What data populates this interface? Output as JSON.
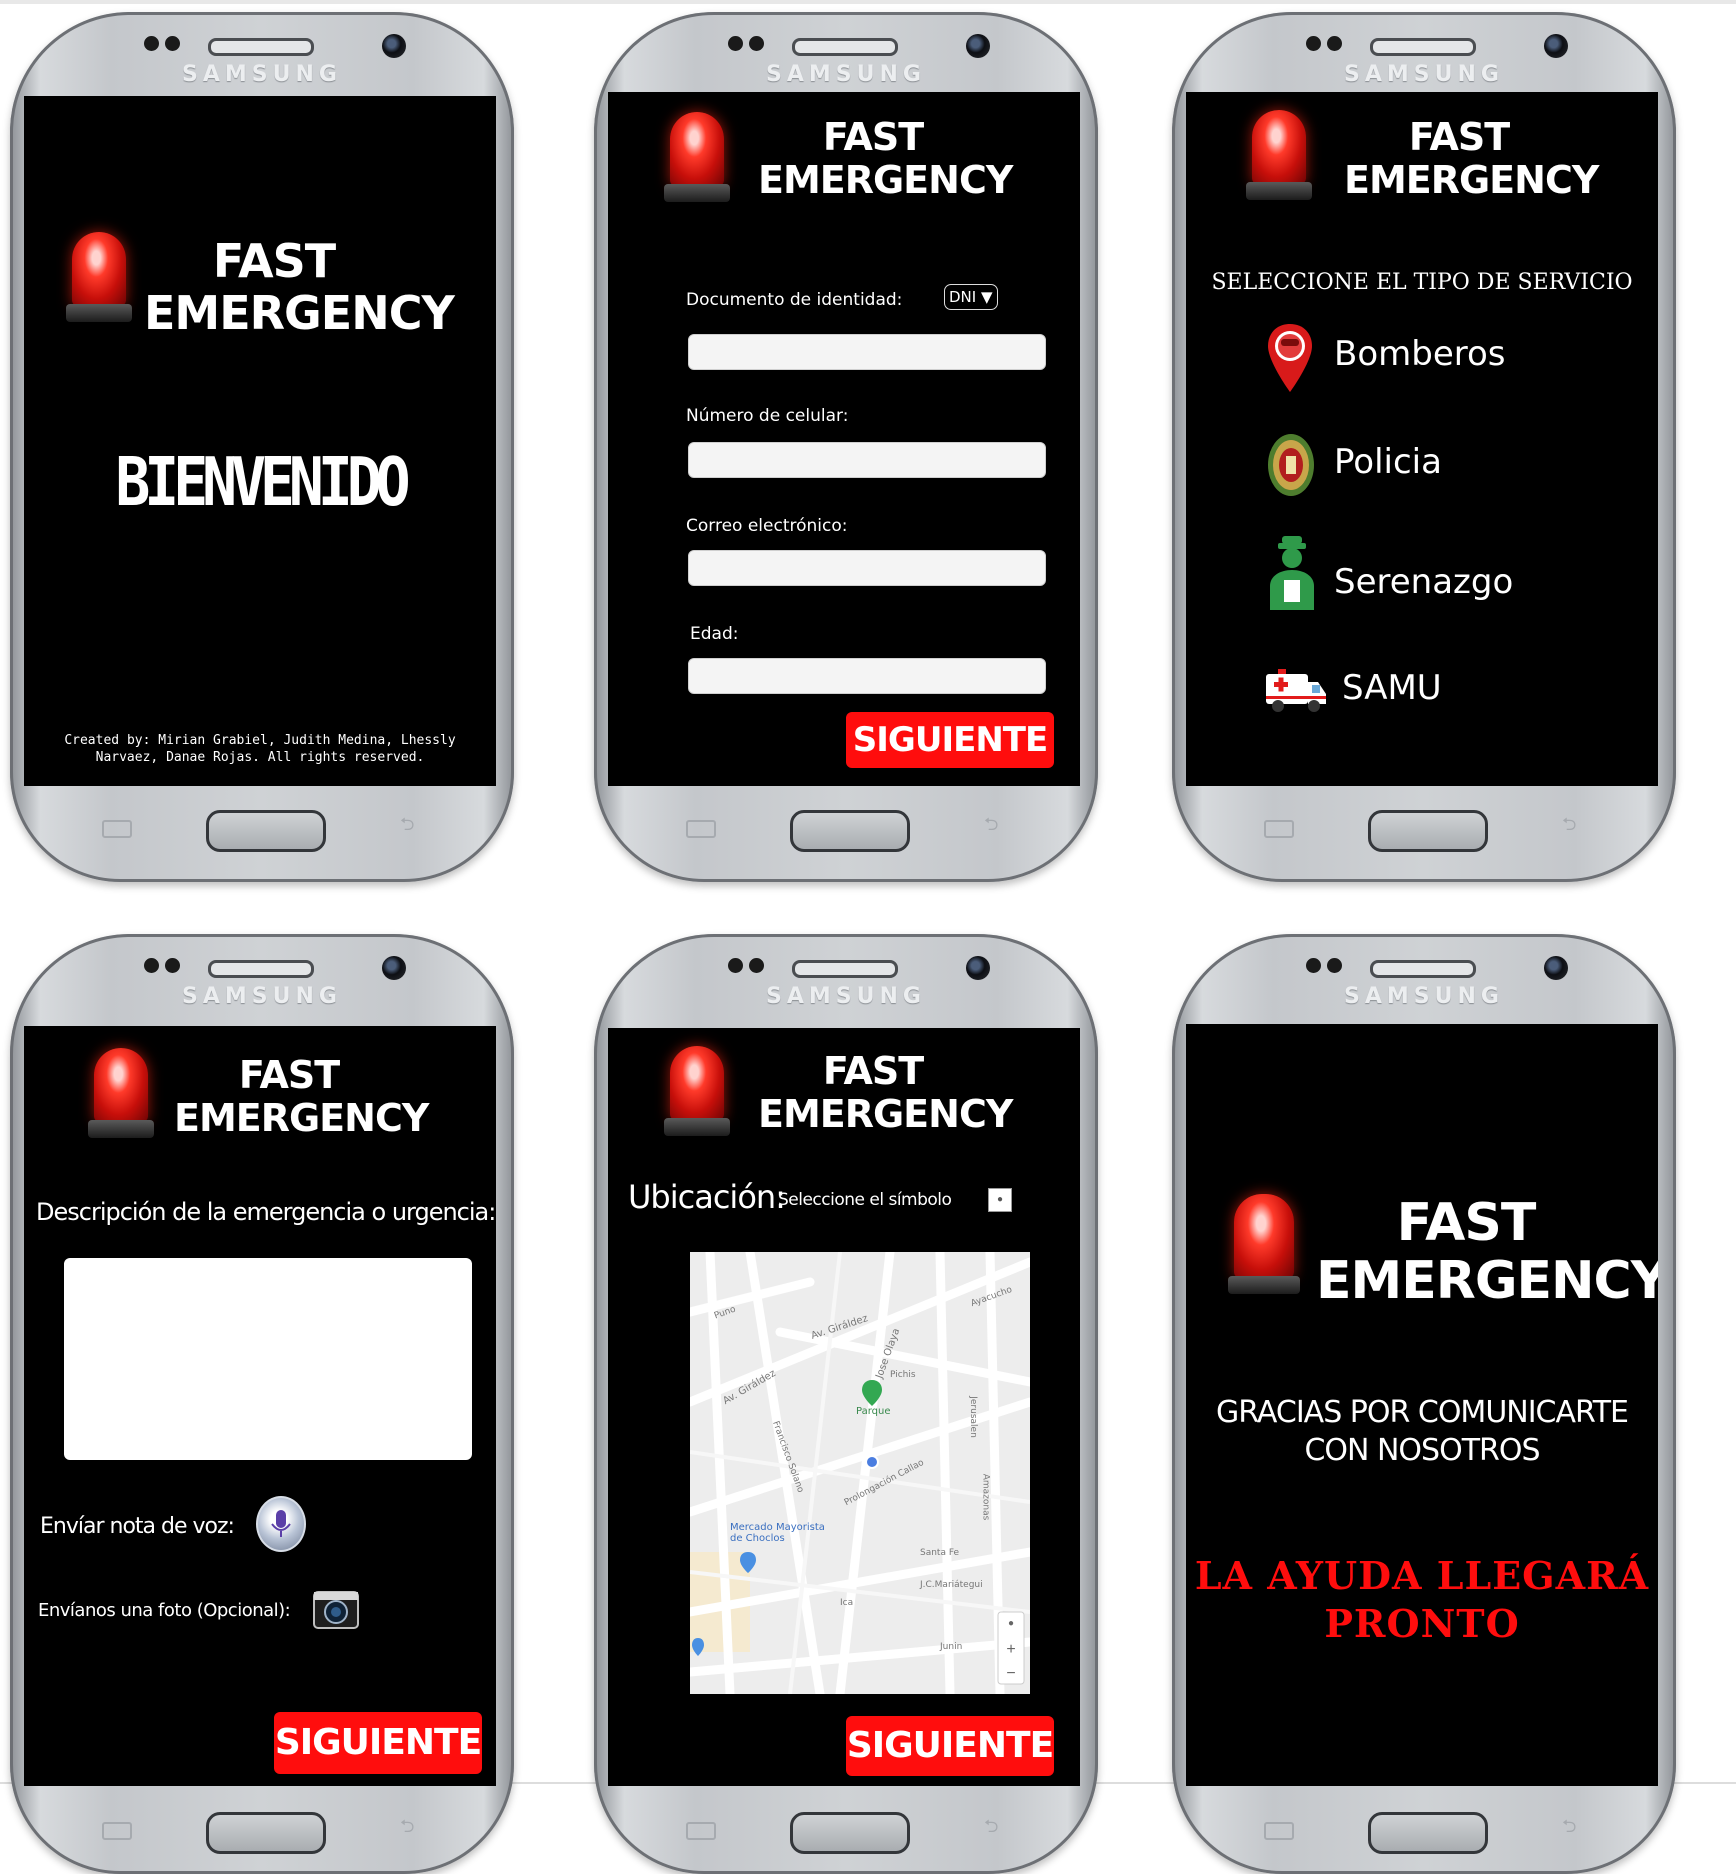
{
  "app": {
    "name_line1": "FAST",
    "name_line2": "EMERGENCY",
    "phone_brand": "SAMSUNG"
  },
  "screen1": {
    "welcome": "BIENVENIDO",
    "credits_line1": "Created by: Mirian Grabiel, Judith Medina, Lhessly",
    "credits_line2": "Narvaez, Danae Rojas. All rights reserved."
  },
  "screen2": {
    "doc_label": "Documento de identidad:",
    "doc_type": "DNI ▼",
    "doc_value": "",
    "phone_label": "Número de celular:",
    "phone_value": "",
    "email_label": "Correo electrónico:",
    "email_value": "",
    "age_label": "Edad:",
    "age_value": "",
    "next_label": "SIGUIENTE"
  },
  "screen3": {
    "title": "SELECCIONE EL TIPO DE SERVICIO",
    "services": [
      {
        "label": "Bomberos",
        "icon": "firefighter-pin-icon"
      },
      {
        "label": "Policia",
        "icon": "police-badge-icon"
      },
      {
        "label": "Serenazgo",
        "icon": "guard-person-icon"
      },
      {
        "label": "SAMU",
        "icon": "ambulance-icon"
      }
    ]
  },
  "screen4": {
    "description_label": "Descripción de la emergencia o urgencia:",
    "description_value": "",
    "voice_label": "Envíar nota de voz:",
    "photo_label": "Envíanos una foto (Opcional):",
    "next_label": "SIGUIENTE"
  },
  "screen5": {
    "location_label": "Ubicación:",
    "select_symbol_label": "Seleccione el símbolo",
    "map_labels": [
      "Av. Giráldez",
      "Av. Giráldez",
      "Parque",
      "Jose Olaya",
      "Mercado Mayorista de Choclos",
      "Pichis",
      "Santa Fe",
      "J.C.Mariátegui",
      "Ica",
      "Junin",
      "Prolongación Callao",
      "Francisco Solano",
      "Jerusalen",
      "Amazonas",
      "Puno",
      "Ayacucho"
    ],
    "next_label": "SIGUIENTE"
  },
  "screen6": {
    "thanks_line1": "GRACIAS POR COMUNICARTE",
    "thanks_line2": "CON NOSOTROS",
    "help_line1": "LA AYUDA LLEGARÁ",
    "help_line2": "PRONTO"
  },
  "colors": {
    "screen_bg": "#000000",
    "accent_red": "#ff0d0d",
    "text_white": "#ffffff",
    "phone_silver": "#c8cbce"
  }
}
